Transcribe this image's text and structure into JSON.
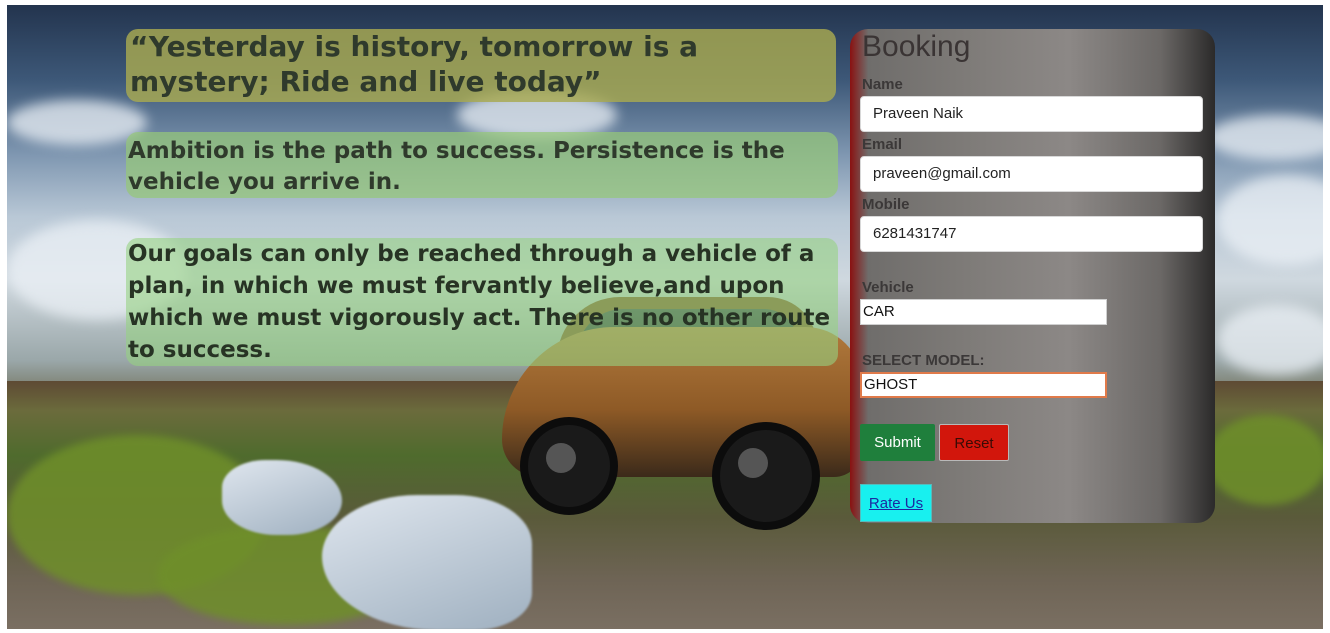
{
  "quotes": {
    "q1": "“Yesterday is history, tomorrow is a mystery; Ride and live today”",
    "q2": "Ambition is the path to success. Persistence is the vehicle you arrive in.",
    "q3": "Our goals can only be reached through a vehicle of a plan, in which we must fervantly believe,and upon which we must vigorously act. There is no other route to success."
  },
  "booking": {
    "title": "Booking",
    "name_label": "Name",
    "name_value": "Praveen Naik",
    "email_label": "Email",
    "email_value": "praveen@gmail.com",
    "mobile_label": "Mobile",
    "mobile_value": "6281431747",
    "vehicle_label": "Vehicle",
    "vehicle_value": "CAR",
    "model_label": "SELECT MODEL:",
    "model_value": "GHOST",
    "submit_label": "Submit",
    "reset_label": "Reset",
    "rate_label": "Rate Us"
  },
  "colors": {
    "submit": "#1f7f3c",
    "reset": "#d2160c",
    "rate": "#18f0ef"
  }
}
